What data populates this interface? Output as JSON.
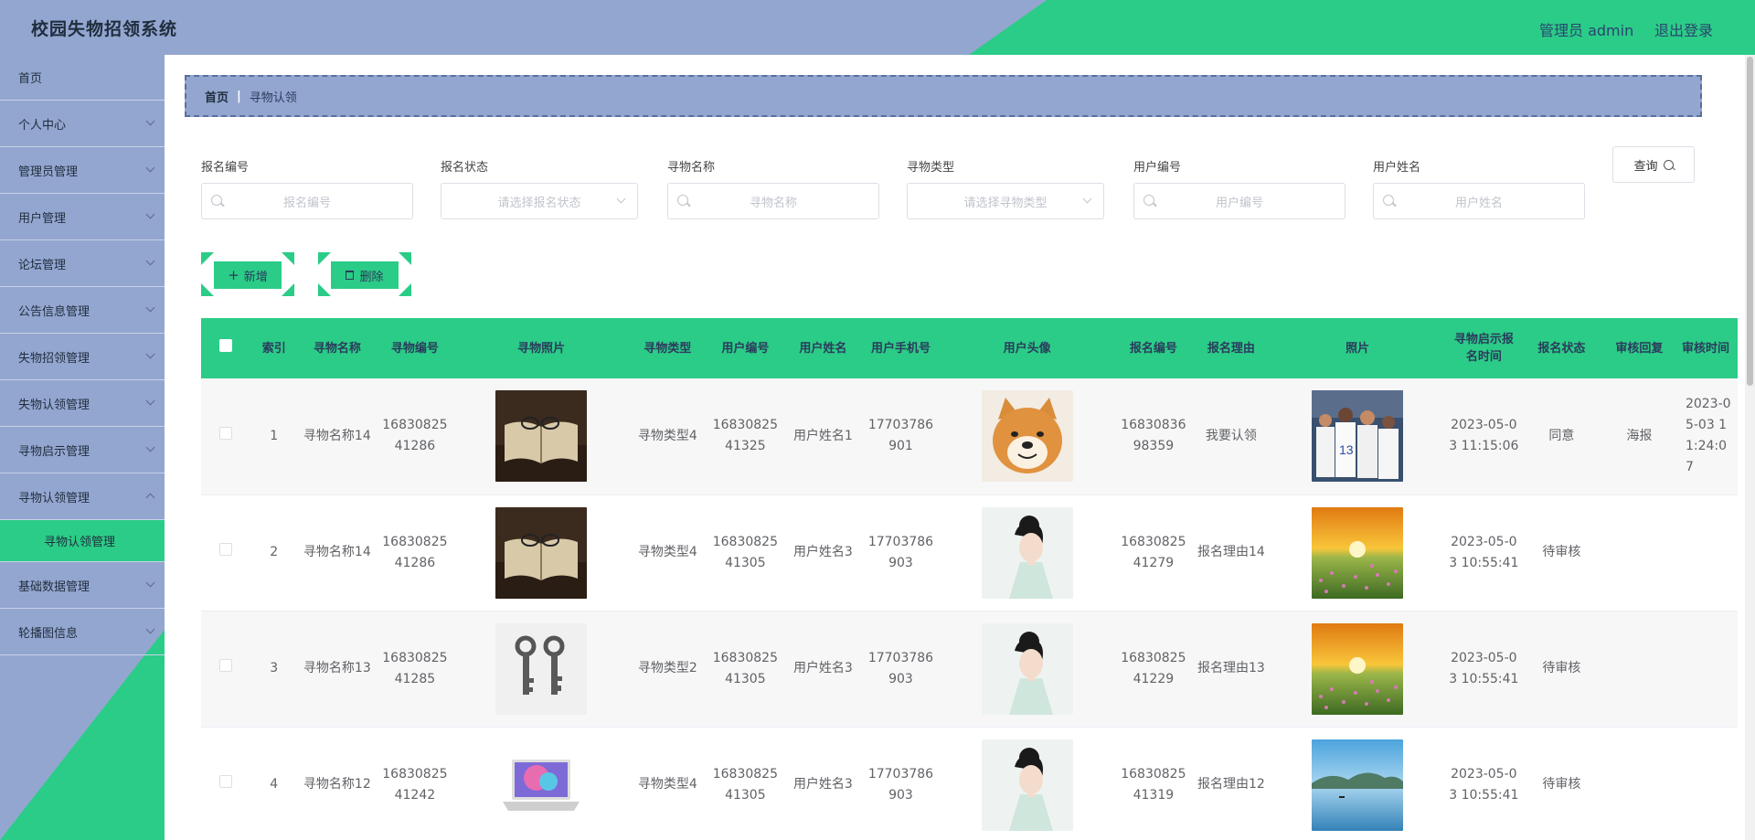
{
  "header": {
    "title": "校园失物招领系统",
    "user": "管理员 admin",
    "logout": "退出登录"
  },
  "sidebar": {
    "items": [
      {
        "label": "首页"
      },
      {
        "label": "个人中心"
      },
      {
        "label": "管理员管理"
      },
      {
        "label": "用户管理"
      },
      {
        "label": "论坛管理"
      },
      {
        "label": "公告信息管理"
      },
      {
        "label": "失物招领管理"
      },
      {
        "label": "失物认领管理"
      },
      {
        "label": "寻物启示管理"
      },
      {
        "label": "寻物认领管理"
      },
      {
        "label": "基础数据管理"
      },
      {
        "label": "轮播图信息"
      }
    ],
    "active_sub": "寻物认领管理"
  },
  "breadcrumb": {
    "home": "首页",
    "sep": "|",
    "current": "寻物认领"
  },
  "filters": {
    "baoming_no": {
      "label": "报名编号",
      "placeholder": "报名编号"
    },
    "baoming_status": {
      "label": "报名状态",
      "placeholder": "请选择报名状态"
    },
    "goods_name": {
      "label": "寻物名称",
      "placeholder": "寻物名称"
    },
    "goods_type": {
      "label": "寻物类型",
      "placeholder": "请选择寻物类型"
    },
    "user_no": {
      "label": "用户编号",
      "placeholder": "用户编号"
    },
    "user_name": {
      "label": "用户姓名",
      "placeholder": "用户姓名"
    },
    "query": "查询"
  },
  "actions": {
    "add": "新增",
    "delete": "删除"
  },
  "table": {
    "headers": [
      "",
      "索引",
      "寻物名称",
      "寻物编号",
      "寻物照片",
      "寻物类型",
      "用户编号",
      "用户姓名",
      "用户手机号",
      "用户头像",
      "报名编号",
      "报名理由",
      "照片",
      "寻物启示报名时间",
      "报名状态",
      "审核回复",
      "审核时间"
    ],
    "rows": [
      {
        "index": "1",
        "goods_name": "寻物名称14",
        "goods_no": "1683082541286",
        "goods_type": "寻物类型4",
        "user_no": "1683082541325",
        "user_name": "用户姓名1",
        "phone": "17703786901",
        "baoming_no": "1683083698359",
        "reason": "我要认领",
        "time": "2023-05-03 11:15:06",
        "status": "同意",
        "reply": "海报",
        "audit_time": "2023-05-03 11:24:07",
        "goods_img": "book",
        "avatar": "dog",
        "photo": "basketball"
      },
      {
        "index": "2",
        "goods_name": "寻物名称14",
        "goods_no": "1683082541286",
        "goods_type": "寻物类型4",
        "user_no": "1683082541305",
        "user_name": "用户姓名3",
        "phone": "17703786903",
        "baoming_no": "1683082541279",
        "reason": "报名理由14",
        "time": "2023-05-03 10:55:41",
        "status": "待审核",
        "reply": "",
        "audit_time": "",
        "goods_img": "book",
        "avatar": "woman",
        "photo": "sunset"
      },
      {
        "index": "3",
        "goods_name": "寻物名称13",
        "goods_no": "1683082541285",
        "goods_type": "寻物类型2",
        "user_no": "1683082541305",
        "user_name": "用户姓名3",
        "phone": "17703786903",
        "baoming_no": "1683082541229",
        "reason": "报名理由13",
        "time": "2023-05-03 10:55:41",
        "status": "待审核",
        "reply": "",
        "audit_time": "",
        "goods_img": "keys",
        "avatar": "woman",
        "photo": "sunset"
      },
      {
        "index": "4",
        "goods_name": "寻物名称12",
        "goods_no": "1683082541242",
        "goods_type": "寻物类型4",
        "user_no": "1683082541305",
        "user_name": "用户姓名3",
        "phone": "17703786903",
        "baoming_no": "1683082541319",
        "reason": "报名理由12",
        "time": "2023-05-03 10:55:41",
        "status": "待审核",
        "reply": "",
        "audit_time": "",
        "goods_img": "laptop",
        "avatar": "woman",
        "photo": "lake"
      }
    ]
  },
  "colors": {
    "accent": "#2bcc87",
    "slate": "#93a6d0"
  }
}
